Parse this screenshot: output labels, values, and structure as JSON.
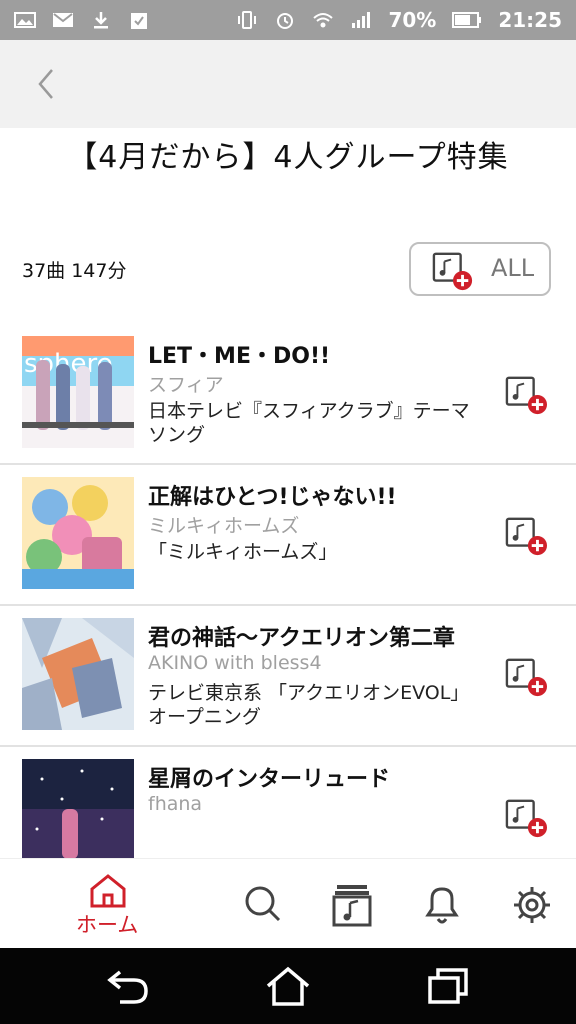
{
  "status_bar": {
    "left_icons": [
      "gallery-icon",
      "mail-icon",
      "download-icon",
      "clipboard-check-icon"
    ],
    "right_icons": [
      "vibrate-icon",
      "alarm-icon",
      "wifi-icon",
      "signal-icon",
      "battery-icon"
    ],
    "battery": "70%",
    "time": "21:25"
  },
  "header": {
    "back_icon": "chevron-left-icon"
  },
  "page": {
    "title": "【4月だから】4人グループ特集",
    "summary": "37曲 147分",
    "all_button_label": "ALL"
  },
  "songs": [
    {
      "title": "LET・ME・DO!!",
      "artist": "スフィア",
      "description": "日本テレビ『スフィアクラブ』テーマソング"
    },
    {
      "title": "正解はひとつ!じゃない!!",
      "artist": "ミルキィホームズ",
      "description": "「ミルキィホームズ」"
    },
    {
      "title": "君の神話〜アクエリオン第二章",
      "artist": "AKINO with bless4",
      "description": "テレビ東京系 「アクエリオンEVOL」 オープニング"
    },
    {
      "title": "星屑のインターリュード",
      "artist": "fhana",
      "description": ""
    }
  ],
  "tabbar": {
    "home_label": "ホーム",
    "icons": [
      "home-icon",
      "search-icon",
      "library-icon",
      "bell-icon",
      "gear-icon"
    ]
  },
  "colors": {
    "accent": "#d0202a",
    "status_bar": "#9e9e9e",
    "nav_bar": "#f1f1f1"
  }
}
